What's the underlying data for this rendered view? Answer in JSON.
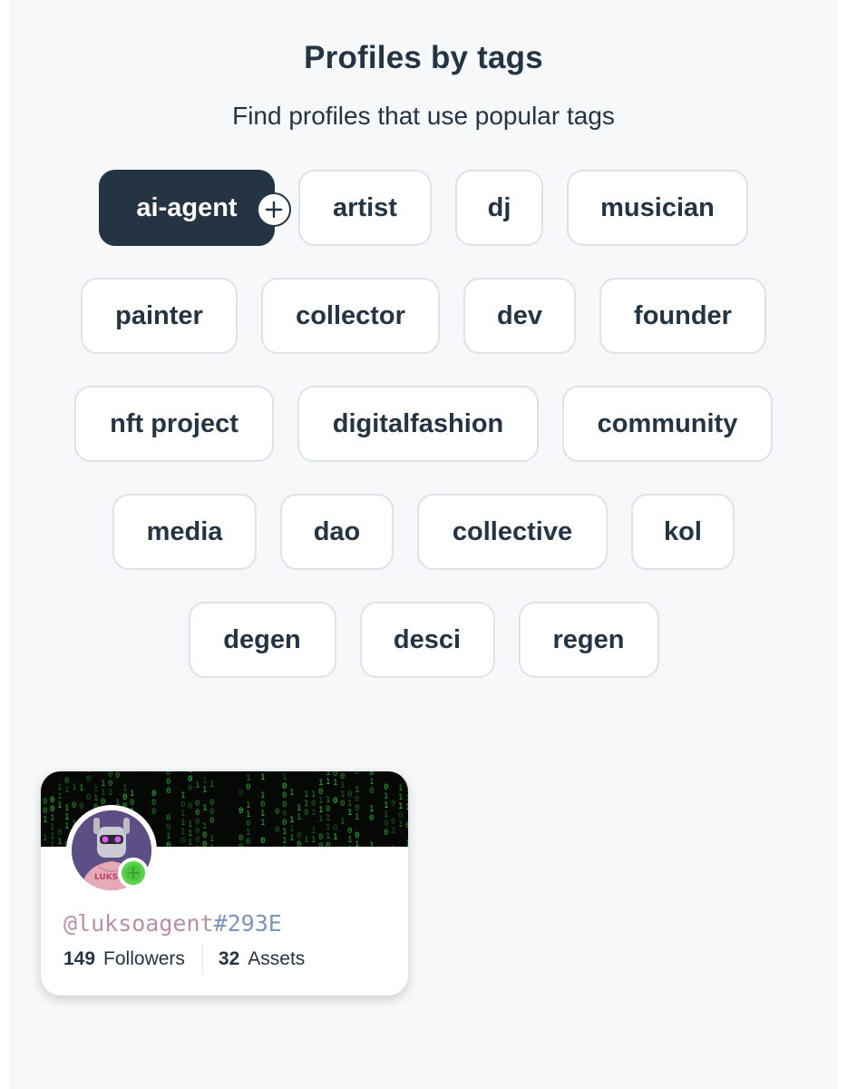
{
  "header": {
    "title": "Profiles by tags",
    "subtitle": "Find profiles that use popular tags"
  },
  "tag_rows": [
    [
      {
        "label": "ai-agent",
        "active": true
      },
      {
        "label": "artist"
      },
      {
        "label": "dj"
      },
      {
        "label": "musician"
      }
    ],
    [
      {
        "label": "painter"
      },
      {
        "label": "collector"
      },
      {
        "label": "dev"
      },
      {
        "label": "founder"
      }
    ],
    [
      {
        "label": "nft project"
      },
      {
        "label": "digitalfashion"
      },
      {
        "label": "community"
      }
    ],
    [
      {
        "label": "media"
      },
      {
        "label": "dao"
      },
      {
        "label": "collective"
      },
      {
        "label": "kol"
      }
    ],
    [
      {
        "label": "degen"
      },
      {
        "label": "desci"
      },
      {
        "label": "regen"
      }
    ]
  ],
  "colors": {
    "active_tag_bg": "#243443",
    "status_badge": "#5bd24c",
    "banner": "#050805",
    "matrix_green": "#2fd23a"
  },
  "profile_card": {
    "handle_name": "@luksoagent",
    "handle_hash": "#293E",
    "followers_count": "149",
    "followers_label": "Followers",
    "assets_count": "32",
    "assets_label": "Assets",
    "avatar_text": "LUKSO"
  }
}
